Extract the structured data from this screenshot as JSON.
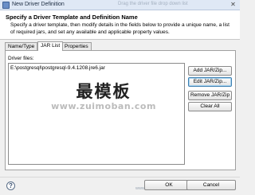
{
  "window": {
    "title": "New Driver Definition",
    "faded_hint": "Drag the driver file drop down list"
  },
  "header": {
    "title": "Specify a Driver Template and Definition Name",
    "description": "Specify a driver template, then modify details in the fields below to provide a unique name, a list of required jars, and set any available and applicable property values."
  },
  "tabs": [
    {
      "label": "Name/Type",
      "active": false
    },
    {
      "label": "JAR List",
      "active": true
    },
    {
      "label": "Properties",
      "active": false
    }
  ],
  "driver_files": {
    "label": "Driver files:",
    "items": [
      "E:\\postgresql\\postgresql-9.4.1208.jre6.jar"
    ]
  },
  "side_buttons": {
    "add": "Add JAR/Zip...",
    "edit": "Edit JAR/Zip...",
    "remove": "Remove JAR/Zip",
    "clear": "Clear All"
  },
  "watermark": {
    "line1": "最模板",
    "line2": "www.zuimoban.com",
    "footer_url": "www.zuimoban.com"
  },
  "footer": {
    "help_icon": "question-mark-icon",
    "ok": "OK",
    "cancel": "Cancel"
  }
}
